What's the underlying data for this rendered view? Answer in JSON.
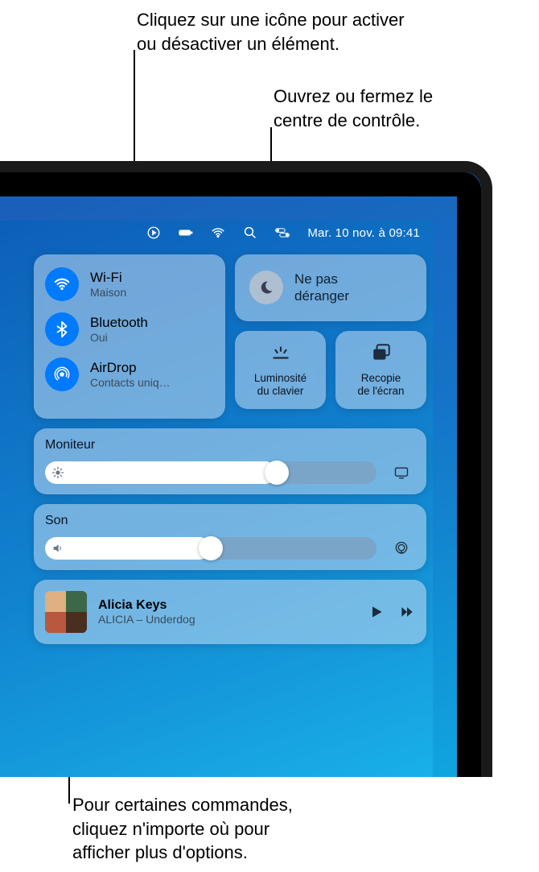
{
  "callouts": {
    "top1": "Cliquez sur une icône pour activer\nou désactiver un élément.",
    "top2": "Ouvrez ou fermez le\ncentre de contrôle.",
    "bottom": "Pour certaines commandes,\ncliquez n'importe où pour\nafficher plus d'options."
  },
  "menubar": {
    "datetime": "Mar. 10 nov. à   09:41"
  },
  "toggles": {
    "wifi": {
      "title": "Wi-Fi",
      "sub": "Maison"
    },
    "bluetooth": {
      "title": "Bluetooth",
      "sub": "Oui"
    },
    "airdrop": {
      "title": "AirDrop",
      "sub": "Contacts uniq…"
    }
  },
  "dnd": {
    "label": "Ne pas\ndéranger"
  },
  "small": {
    "keyboard": "Luminosité\ndu clavier",
    "mirror": "Recopie\nde l'écran"
  },
  "display": {
    "title": "Moniteur",
    "value": 0.7
  },
  "sound": {
    "title": "Son",
    "value": 0.5
  },
  "nowPlaying": {
    "artist": "Alicia Keys",
    "track": "ALICIA – Underdog"
  }
}
